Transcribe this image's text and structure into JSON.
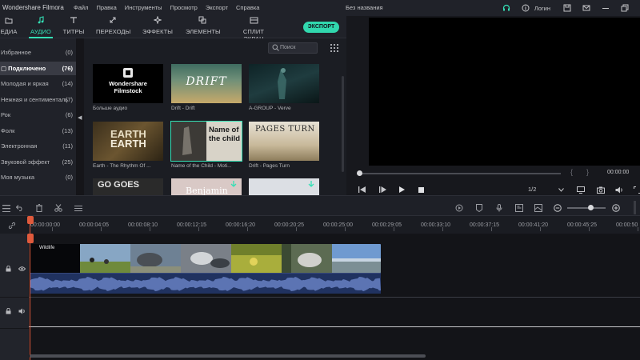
{
  "titlebar": {
    "app_name": "Wondershare Filmora",
    "menu": [
      "Файл",
      "Правка",
      "Инструменты",
      "Просмотр",
      "Экспорт",
      "Справка"
    ],
    "document_title": "Без названия",
    "login_label": "Логин"
  },
  "tabs": [
    {
      "label": "ЕДИА",
      "icon": "folder-icon"
    },
    {
      "label": "АУДИО",
      "icon": "music-note-icon",
      "active": true
    },
    {
      "label": "ТИТРЫ",
      "icon": "text-icon"
    },
    {
      "label": "ПЕРЕХОДЫ",
      "icon": "transition-icon"
    },
    {
      "label": "ЭФФЕКТЫ",
      "icon": "effects-icon"
    },
    {
      "label": "ЭЛЕМЕНТЫ",
      "icon": "elements-icon"
    },
    {
      "label": "СПЛИТ ЭКРАН",
      "icon": "split-screen-icon"
    }
  ],
  "export_label": "ЭКСПОРТ",
  "categories": [
    {
      "name": "Избранное",
      "count": "(0)"
    },
    {
      "name": "Подключено",
      "count": "(76)",
      "active": true
    },
    {
      "name": "Молодая и яркая",
      "count": "(14)"
    },
    {
      "name": "Нежная и сентиментальная",
      "count": "(7)"
    },
    {
      "name": "Рок",
      "count": "(6)"
    },
    {
      "name": "Фолк",
      "count": "(13)"
    },
    {
      "name": "Электронная",
      "count": "(11)"
    },
    {
      "name": "Звуковой эффект",
      "count": "(25)"
    },
    {
      "name": "Моя музыка",
      "count": "(0)"
    }
  ],
  "search": {
    "placeholder": "Поиск"
  },
  "media_items": [
    {
      "label": "Больше аудио",
      "thumb_text": "Wondershare\nFilmstock"
    },
    {
      "label": "Drift - Drift",
      "thumb_text": "DRIFT"
    },
    {
      "label": "A-GROUP - Verve",
      "thumb_text": ""
    },
    {
      "label": "Earth - The Rhythm Of ...",
      "thumb_text": "EARTH"
    },
    {
      "label": "Name of the Child - Moti...",
      "thumb_text": "Name of the child"
    },
    {
      "label": "Drift - Pages Turn",
      "thumb_text": "PAGES TURN"
    },
    {
      "label": "",
      "thumb_text": "GO GOES"
    },
    {
      "label": "",
      "thumb_text": "Benjamin"
    },
    {
      "label": "",
      "thumb_text": ""
    }
  ],
  "preview": {
    "timecode": "00:00:00",
    "ratio": "1/2"
  },
  "ruler": [
    "00:00:00:00",
    "00:00:04:05",
    "00:00:08:10",
    "00:00:12:15",
    "00:00:16:20",
    "00:00:20:25",
    "00:00:25:00",
    "00:00:29:05",
    "00:00:33:10",
    "00:00:37:15",
    "00:00:41:20",
    "00:00:45:25",
    "00:00:50"
  ],
  "clip": {
    "title": "Wildlife"
  },
  "colors": {
    "accent": "#34e0b5",
    "export": "#31d8ae",
    "playhead": "#e05a3c",
    "clip_video": "#2b3d66",
    "clip_audio": "#203260"
  }
}
